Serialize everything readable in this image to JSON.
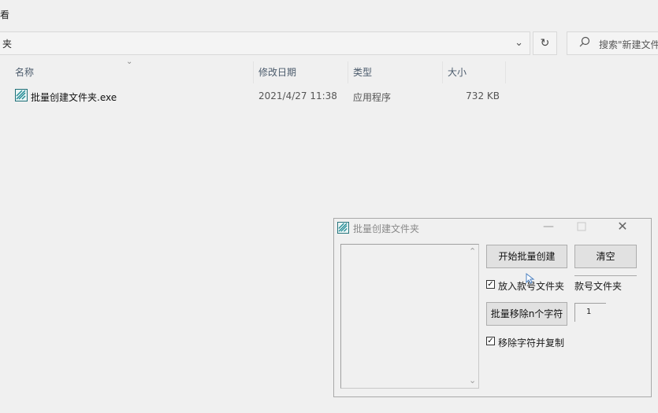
{
  "explorer": {
    "menu_fragment": "看",
    "address_fragment": "夹",
    "refresh_icon": "refresh-icon",
    "search_placeholder": "搜索\"新建文件",
    "columns": {
      "name": "名称",
      "date": "修改日期",
      "type": "类型",
      "size": "大小"
    },
    "files": [
      {
        "name": "批量创建文件夹.exe",
        "date": "2021/4/27 11:38",
        "type": "应用程序",
        "size": "732 KB"
      }
    ]
  },
  "dialog": {
    "title": "批量创建文件夹",
    "start_button": "开始批量创建",
    "clear_button": "清空",
    "put_into_checkbox": {
      "label": "放入款号文件夹",
      "checked": true
    },
    "suffix_label": "款号文件夹",
    "remove_button": "批量移除n个字符",
    "remove_count": "1",
    "remove_copy_checkbox": {
      "label": "移除字符并复制",
      "checked": true
    }
  }
}
